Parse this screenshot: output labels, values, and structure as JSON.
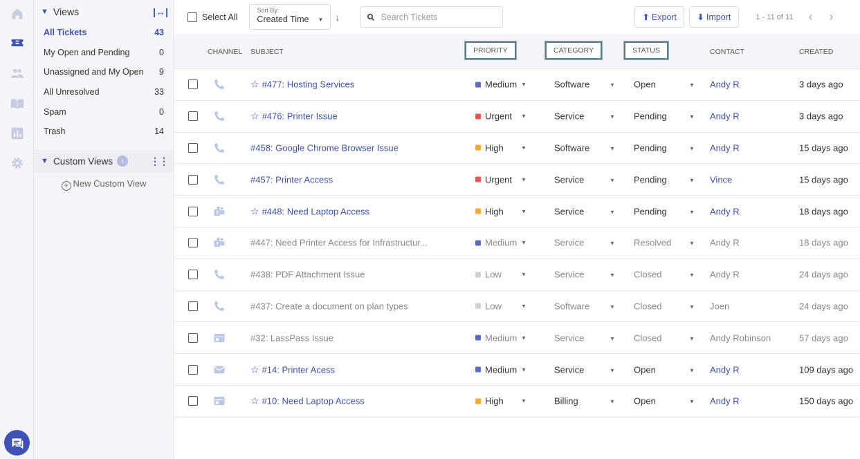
{
  "rail": {
    "icons": [
      "home-icon",
      "ticket-icon",
      "contacts-icon",
      "knowledge-base-icon",
      "reports-icon",
      "settings-icon"
    ],
    "active": "ticket-icon",
    "accent": "#3f51b5"
  },
  "views": {
    "title": "Views",
    "items": [
      {
        "label": "All Tickets",
        "count": "43",
        "active": true
      },
      {
        "label": "My Open and Pending",
        "count": "0"
      },
      {
        "label": "Unassigned and My Open",
        "count": "9"
      },
      {
        "label": "All Unresolved",
        "count": "33"
      },
      {
        "label": "Spam",
        "count": "0"
      },
      {
        "label": "Trash",
        "count": "14"
      }
    ],
    "custom_title": "Custom Views",
    "custom_info": "i",
    "new_custom": "New Custom View"
  },
  "toolbar": {
    "select_all": "Select All",
    "sort_label": "Sort By:",
    "sort_value": "Created Time",
    "search_placeholder": "Search Tickets",
    "export_label": "Export",
    "import_label": "Import",
    "pager": "1 - 11 of 11"
  },
  "columns": {
    "channel": "CHANNEL",
    "subject": "SUBJECT",
    "priority": "PRIORITY",
    "category": "CATEGORY",
    "status": "STATUS",
    "contact": "CONTACT",
    "created": "CREATED"
  },
  "priority_colors": {
    "Medium": "#5c6bc0",
    "Urgent": "#ef5350",
    "High": "#ffa726",
    "Low": "#d0d0d0"
  },
  "tickets": [
    {
      "channel": "phone-icon",
      "star": true,
      "subject": "#477: Hosting Services",
      "priority": "Medium",
      "category": "Software",
      "status": "Open",
      "contact": "Andy R",
      "created": "3 days ago",
      "muted": false
    },
    {
      "channel": "phone-icon",
      "star": true,
      "subject": "#476: Printer Issue",
      "priority": "Urgent",
      "category": "Service",
      "status": "Pending",
      "contact": "Andy R",
      "created": "3 days ago",
      "muted": false
    },
    {
      "channel": "phone-icon",
      "star": false,
      "subject": "#458: Google Chrome Browser Issue",
      "priority": "High",
      "category": "Software",
      "status": "Pending",
      "contact": "Andy R",
      "created": "15 days ago",
      "muted": false
    },
    {
      "channel": "phone-icon",
      "star": false,
      "subject": "#457: Printer Access",
      "priority": "Urgent",
      "category": "Service",
      "status": "Pending",
      "contact": "Vince",
      "created": "15 days ago",
      "muted": false
    },
    {
      "channel": "teams-icon",
      "star": true,
      "subject": "#448: Need Laptop Access",
      "priority": "High",
      "category": "Service",
      "status": "Pending",
      "contact": "Andy R",
      "created": "18 days ago",
      "muted": false
    },
    {
      "channel": "teams-icon",
      "star": false,
      "subject": "#447: Need Printer Access for Infrastructur...",
      "priority": "Medium",
      "category": "Service",
      "status": "Resolved",
      "contact": "Andy R",
      "created": "18 days ago",
      "muted": true
    },
    {
      "channel": "phone-icon",
      "star": false,
      "subject": "#438: PDF Attachment Issue",
      "priority": "Low",
      "category": "Service",
      "status": "Closed",
      "contact": "Andy R",
      "created": "24 days ago",
      "muted": true
    },
    {
      "channel": "phone-icon",
      "star": false,
      "subject": "#437: Create a document on plan types",
      "priority": "Low",
      "category": "Software",
      "status": "Closed",
      "contact": "Joen",
      "created": "24 days ago",
      "muted": true
    },
    {
      "channel": "portal-icon",
      "star": false,
      "subject": "#32: LassPass Issue",
      "priority": "Medium",
      "category": "Service",
      "status": "Closed",
      "contact": "Andy Robinson",
      "created": "57 days ago",
      "muted": true
    },
    {
      "channel": "email-icon",
      "star": true,
      "subject": "#14: Printer Acess",
      "priority": "Medium",
      "category": "Service",
      "status": "Open",
      "contact": "Andy R",
      "created": "109 days ago",
      "muted": false
    },
    {
      "channel": "portal-icon",
      "star": true,
      "subject": "#10: Need Laptop Access",
      "priority": "High",
      "category": "Billing",
      "status": "Open",
      "contact": "Andy R",
      "created": "150 days ago",
      "muted": false
    }
  ]
}
